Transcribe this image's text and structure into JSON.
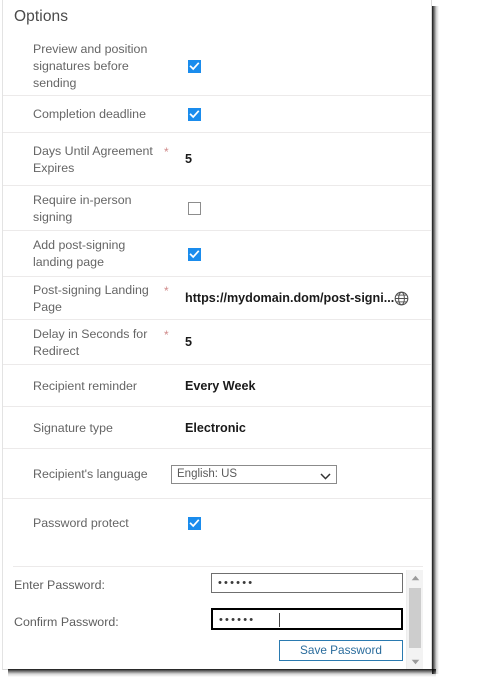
{
  "panel": {
    "title": "Options"
  },
  "rows": [
    {
      "label": "Preview and position signatures before sending",
      "type": "checkbox",
      "checked": true,
      "required": false,
      "name": "preview-and-position-signatures"
    },
    {
      "label": "Completion deadline",
      "type": "checkbox",
      "checked": true,
      "required": false,
      "name": "completion-deadline"
    },
    {
      "label": "Days Until Agreement Expires",
      "type": "value",
      "value": "5",
      "required": true,
      "requiredMark": "*",
      "name": "days-until-agreement-expires"
    },
    {
      "label": "Require in-person signing",
      "type": "checkbox",
      "checked": false,
      "required": false,
      "name": "require-in-person-signing"
    },
    {
      "label": "Add post-signing landing page",
      "type": "checkbox",
      "checked": true,
      "required": false,
      "name": "add-post-signing-landing-page"
    },
    {
      "label": "Post-signing Landing Page",
      "type": "value-with-icon",
      "value": "https://mydomain.dom/post-signi...",
      "icon": "globe-icon",
      "required": true,
      "requiredMark": "*",
      "name": "post-signing-landing-page"
    },
    {
      "label": "Delay in Seconds for Redirect",
      "type": "value",
      "value": "5",
      "required": true,
      "requiredMark": "*",
      "name": "delay-in-seconds-for-redirect"
    },
    {
      "label": "Recipient reminder",
      "type": "value",
      "value": "Every Week",
      "required": false,
      "name": "recipient-reminder"
    },
    {
      "label": "Signature type",
      "type": "value",
      "value": "Electronic",
      "required": false,
      "name": "signature-type"
    },
    {
      "label": "Recipient's language",
      "type": "select",
      "value": "English: US",
      "required": false,
      "name": "recipients-language"
    },
    {
      "label": "Password protect",
      "type": "checkbox",
      "checked": true,
      "required": false,
      "name": "password-protect"
    }
  ],
  "password_section": {
    "enter_label": "Enter Password:",
    "enter_value": "••••••",
    "confirm_label": "Confirm Password:",
    "confirm_value": "••••••",
    "save_label": "Save Password"
  },
  "colors": {
    "checkbox_accent": "#1a8ced",
    "required_mark": "#d08a8a",
    "button_blue": "#2a6c9c"
  }
}
